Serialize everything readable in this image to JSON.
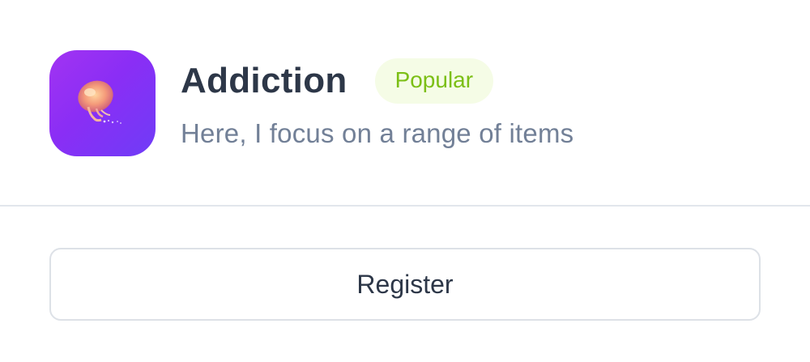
{
  "app": {
    "icon": "jellyfish-app-icon",
    "title": "Addiction",
    "badge": "Popular",
    "subtitle": "Here, I focus on a range of items"
  },
  "actions": {
    "register_label": "Register"
  },
  "colors": {
    "title": "#2d3748",
    "subtitle": "#728097",
    "badge_text": "#7cbf16",
    "badge_bg": "#f5fce6",
    "icon_gradient_start": "#a233f2",
    "icon_gradient_end": "#6f3cf7",
    "divider": "#e2e6ec",
    "button_border": "#dde1e7"
  }
}
